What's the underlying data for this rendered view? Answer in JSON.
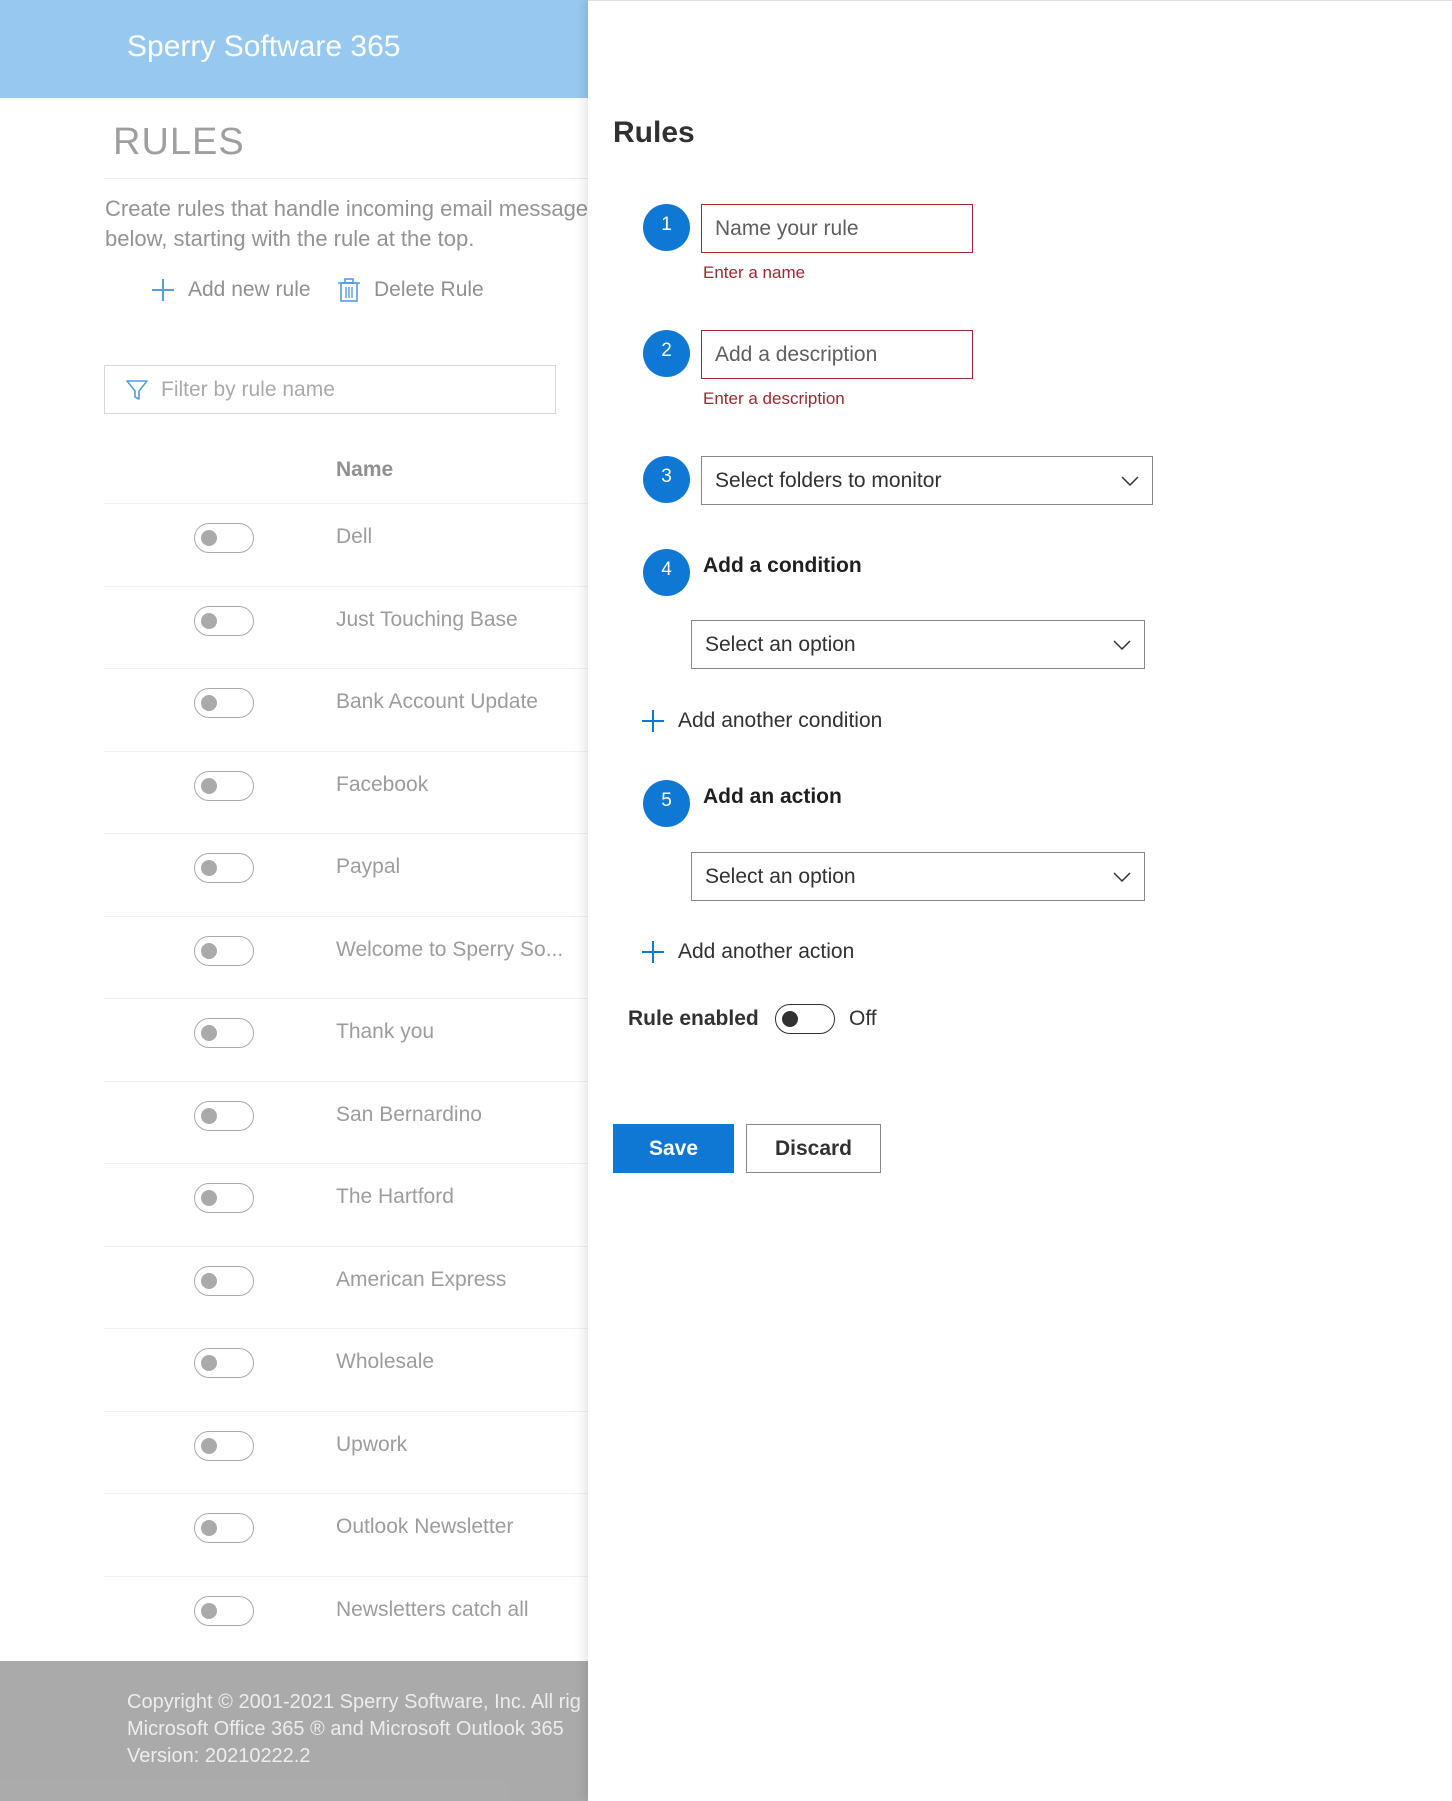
{
  "app": {
    "title": "Sperry Software 365"
  },
  "rules_page": {
    "heading": "RULES",
    "intro_line1": "Create rules that handle incoming email message",
    "intro_line2": "below, starting with the rule at the top.",
    "add_rule_label": "Add new rule",
    "delete_rule_label": "Delete Rule",
    "filter_placeholder": "Filter by rule name",
    "name_column": "Name",
    "rules": [
      {
        "name": "Dell",
        "enabled": false
      },
      {
        "name": "Just Touching Base",
        "enabled": false
      },
      {
        "name": "Bank Account Update",
        "enabled": false
      },
      {
        "name": "Facebook",
        "enabled": false
      },
      {
        "name": "Paypal",
        "enabled": false
      },
      {
        "name": "Welcome to Sperry So...",
        "enabled": false
      },
      {
        "name": "Thank you",
        "enabled": false
      },
      {
        "name": "San Bernardino",
        "enabled": false
      },
      {
        "name": "The Hartford",
        "enabled": false
      },
      {
        "name": "American Express",
        "enabled": false
      },
      {
        "name": "Wholesale",
        "enabled": false
      },
      {
        "name": "Upwork",
        "enabled": false
      },
      {
        "name": "Outlook Newsletter",
        "enabled": false
      },
      {
        "name": "Newsletters catch all",
        "enabled": false
      }
    ],
    "footer_line1": "Copyright © 2001-2021 Sperry Software, Inc. All rig",
    "footer_line2": "Microsoft Office 365 ® and Microsoft Outlook 365 ",
    "footer_line3": "Version: 20210222.2"
  },
  "panel": {
    "title": "Rules",
    "steps": {
      "one": "1",
      "two": "2",
      "three": "3",
      "four": "4",
      "five": "5"
    },
    "name_placeholder": "Name your rule",
    "name_error": "Enter a name",
    "description_placeholder": "Add a description",
    "description_error": "Enter a description",
    "folders_dropdown": "Select folders to monitor",
    "condition_heading": "Add a condition",
    "condition_dropdown": "Select an option",
    "add_condition": "Add another condition",
    "action_heading": "Add an action",
    "action_dropdown": "Select an option",
    "add_action": "Add another action",
    "rule_enabled_label": "Rule enabled",
    "rule_enabled_state": "Off",
    "save_label": "Save",
    "discard_label": "Discard"
  },
  "colors": {
    "header": "#6fb4ea",
    "accent": "#0f78d4",
    "error": "#a4262c",
    "footer": "#8a8a8a"
  },
  "icons": {
    "add": "plus-icon",
    "delete": "trash-icon",
    "filter": "filter-icon",
    "dropdown": "chevron-down-icon"
  }
}
